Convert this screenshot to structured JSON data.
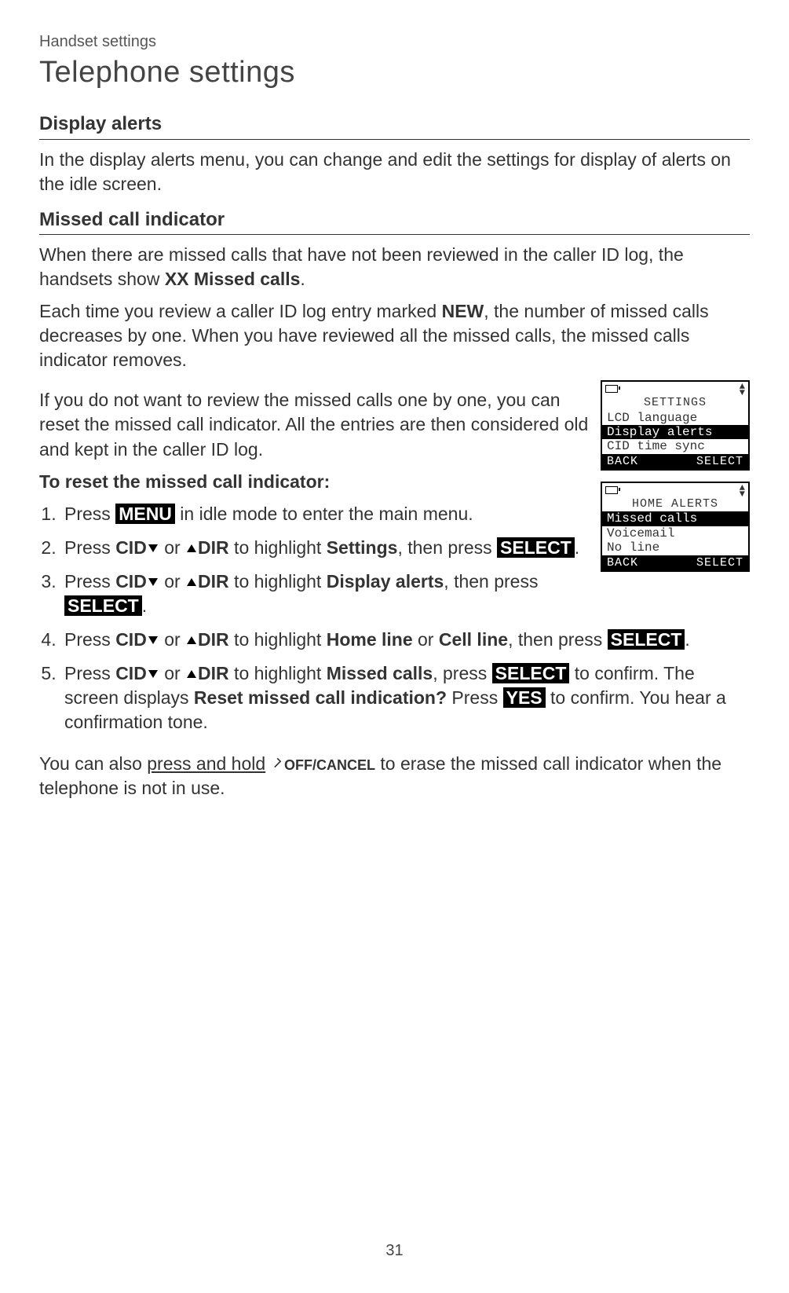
{
  "breadcrumb": "Handset settings",
  "page_title": "Telephone settings",
  "h2_1": "Display alerts",
  "p1": "In the display alerts menu, you can change and edit the settings for display of alerts on the idle screen.",
  "h3_1": "Missed call indicator",
  "p2a": "When there are missed calls that have not been reviewed in the caller ID log, the handsets show ",
  "p2b": "XX Missed calls",
  "p2c": ".",
  "p3a": "Each time you review a caller ID log entry marked ",
  "p3b": "NEW",
  "p3c": ", the number of missed calls decreases by one. When you have reviewed all the missed calls, the missed calls indicator removes.",
  "p4": "If you do not want to review the missed calls one by one, you can reset the missed call indicator. All the entries are then considered old and kept in the caller ID log.",
  "h4_1": "To reset the missed call indicator:",
  "step1_a": "Press ",
  "step1_menu": "MENU",
  "step1_b": " in idle mode to enter the main menu.",
  "step2_a": "Press ",
  "cid": "CID",
  "or": " or ",
  "dir": "DIR",
  "step2_b": " to highlight ",
  "settings": "Settings",
  "step2_c": ", then press ",
  "select": "SELECT",
  "step2_d": ".",
  "step3_b": " to highlight ",
  "display_alerts": "Display alerts",
  "step3_c": ", then press ",
  "step4_b": " to highlight ",
  "home_line": "Home line",
  "or2": " or ",
  "cell_line": "Cell line",
  "step4_c": ", then press ",
  "step5_b": " to highlight ",
  "missed_calls": "Missed calls",
  "step5_c": ", press ",
  "step5_d": " to confirm. The screen displays ",
  "reset_q": "Reset missed call indication?",
  "step5_e": " Press ",
  "yes": "YES",
  "step5_f": " to confirm. You hear a confirmation tone.",
  "p5a": "You can also ",
  "press_hold": "press and hold",
  "off_cancel": "OFF/CANCEL",
  "p5b": " to erase the missed call indicator when the telephone is not in use.",
  "lcd1": {
    "title": "SETTINGS",
    "row1": "LCD language",
    "row2": "Display alerts",
    "row3": "CID time sync",
    "sk_left": "BACK",
    "sk_right": "SELECT"
  },
  "lcd2": {
    "title": "HOME ALERTS",
    "row1": "Missed calls",
    "row2": "Voicemail",
    "row3": "No line",
    "sk_left": "BACK",
    "sk_right": "SELECT"
  },
  "page_number": "31"
}
